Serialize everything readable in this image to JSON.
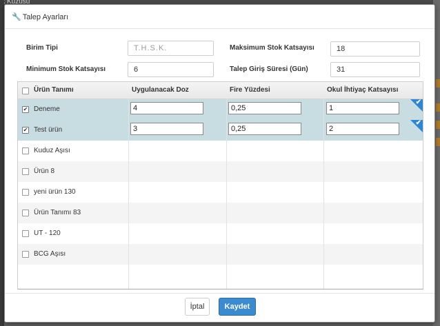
{
  "background": {
    "top_text": "ik Kuzusu"
  },
  "modal": {
    "title": "Talep Ayarları",
    "title_icon": "wrench-icon"
  },
  "form": {
    "birim_tipi": {
      "label": "Birim Tipi",
      "placeholder": "T.H.S.K."
    },
    "minimum_stok": {
      "label": "Minimum Stok Katsayısı",
      "value": "6"
    },
    "maksimum_stok": {
      "label": "Maksimum Stok Katsayısı",
      "value": "18"
    },
    "talep_giris": {
      "label": "Talep Giriş Süresi (Gün)",
      "value": "31"
    }
  },
  "grid": {
    "headers": {
      "urun_tanimi": "Ürün Tanımı",
      "uygulanacak_doz": "Uygulanacak Doz",
      "fire_yuzdesi": "Fire Yüzdesi",
      "okul_ihtiyac": "Okul İhtiyaç Katsayısı"
    },
    "rows": [
      {
        "name": "Deneme",
        "checked": true,
        "doz": "4",
        "fire": "0,25",
        "okul": "1"
      },
      {
        "name": "Test ürün",
        "checked": true,
        "doz": "3",
        "fire": "0,25",
        "okul": "2"
      },
      {
        "name": "Kuduz Aşısı",
        "checked": false
      },
      {
        "name": "Ürün 8",
        "checked": false
      },
      {
        "name": "yeni ürün 130",
        "checked": false
      },
      {
        "name": "Ürün Tanımı 83",
        "checked": false
      },
      {
        "name": "UT - 120",
        "checked": false
      },
      {
        "name": "BCG Aşısı",
        "checked": false
      }
    ],
    "check_mark": "✔"
  },
  "footer": {
    "cancel_label": "İptal",
    "save_label": "Kaydet"
  },
  "colors": {
    "selected_row": "#c8dde2",
    "accent": "#3a8bd0",
    "corner_badge": "#2c86d4"
  }
}
